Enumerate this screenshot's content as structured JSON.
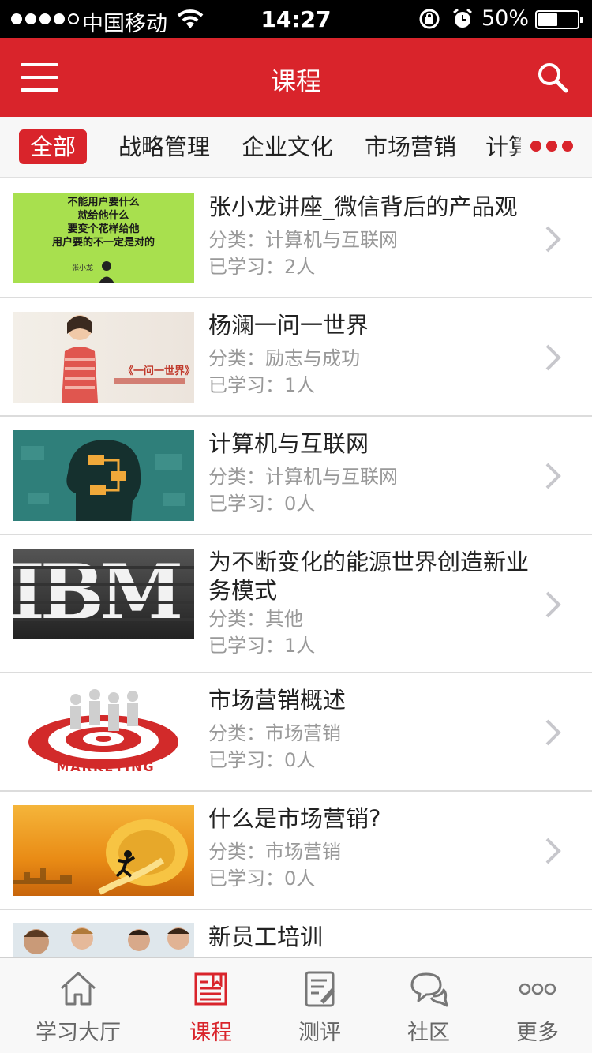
{
  "status_bar": {
    "carrier": "中国移动",
    "time": "14:27",
    "battery": "50%",
    "battery_level": 0.5
  },
  "header": {
    "title": "课程",
    "menu_icon": "hamburger-menu-icon",
    "search_icon": "search-icon"
  },
  "categories": {
    "items": [
      "全部",
      "战略管理",
      "企业文化",
      "市场营销",
      "计算"
    ],
    "active_index": 0,
    "more_icon": "more-dots-icon"
  },
  "courses": [
    {
      "title": "张小龙讲座_微信背后的产品观",
      "category": "分类：计算机与互联网",
      "learners": "已学习：2人",
      "thumb_text": [
        "不能用户要什么",
        "就给他什么",
        "要变个花样给他",
        "用户要的不一定是对的"
      ],
      "thumb_caption": "张小龙"
    },
    {
      "title": "杨澜一问一世界",
      "category": "分类：励志与成功",
      "learners": "已学习：1人",
      "thumb_text": [
        "《一问一世界》"
      ]
    },
    {
      "title": "计算机与互联网",
      "category": "分类：计算机与互联网",
      "learners": "已学习：0人"
    },
    {
      "title": "为不断变化的能源世界创造新业务模式",
      "category": "分类：其他",
      "learners": "已学习：1人",
      "thumb_text": [
        "IBM"
      ]
    },
    {
      "title": "市场营销概述",
      "category": "分类：市场营销",
      "learners": "已学习：0人",
      "thumb_text": [
        "MARKETING"
      ]
    },
    {
      "title": "什么是市场营销?",
      "category": "分类：市场营销",
      "learners": "已学习：0人"
    },
    {
      "title": "新员工培训",
      "category": "",
      "learners": ""
    }
  ],
  "tabbar": {
    "items": [
      {
        "label": "学习大厅",
        "icon": "home-icon"
      },
      {
        "label": "课程",
        "icon": "course-book-icon"
      },
      {
        "label": "测评",
        "icon": "assessment-icon"
      },
      {
        "label": "社区",
        "icon": "chat-bubbles-icon"
      },
      {
        "label": "更多",
        "icon": "more-icon"
      }
    ],
    "active_index": 1
  },
  "colors": {
    "brand_red": "#d9242b",
    "text_primary": "#222222",
    "text_secondary": "#999999"
  }
}
